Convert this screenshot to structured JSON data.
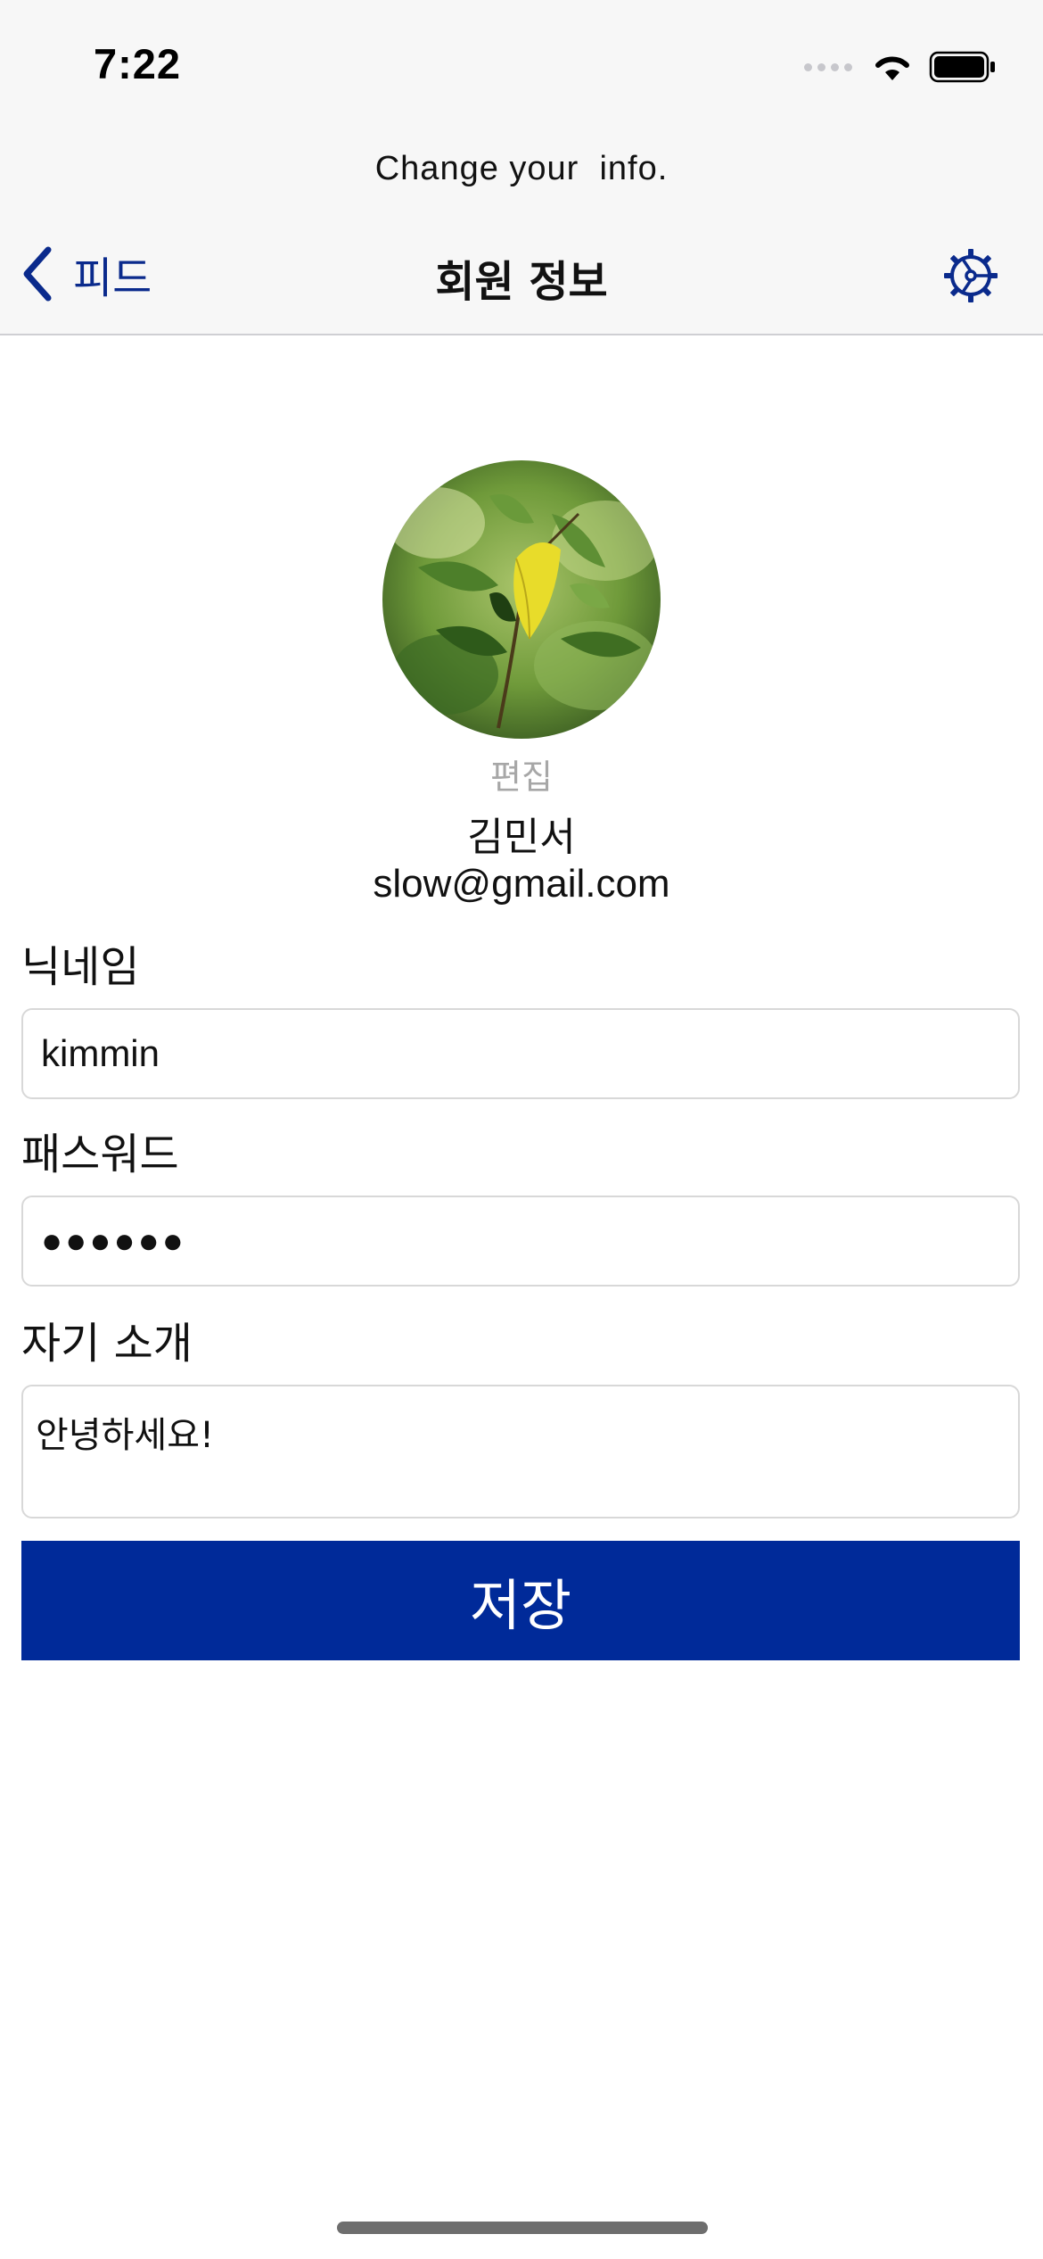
{
  "status_bar": {
    "time": "7:22"
  },
  "prompt": "Change your  info.",
  "nav": {
    "back_label": "피드",
    "title": "회원 정보"
  },
  "profile": {
    "edit_label": "편집",
    "name": "김민서",
    "email": "slow@gmail.com"
  },
  "form": {
    "nickname_label": "닉네임",
    "nickname_value": "kimmin",
    "password_label": "패스워드",
    "password_value": "●●●●●●",
    "bio_label": "자기 소개",
    "bio_value": "안녕하세요!"
  },
  "save_button_label": "저장",
  "colors": {
    "accent": "#002a99",
    "nav_tint": "#0a2a8c",
    "header_bg": "#f7f7f7"
  },
  "icons": [
    "back-chevron-icon",
    "settings-gear-icon",
    "wifi-icon",
    "battery-icon",
    "cellular-signal-icon"
  ]
}
